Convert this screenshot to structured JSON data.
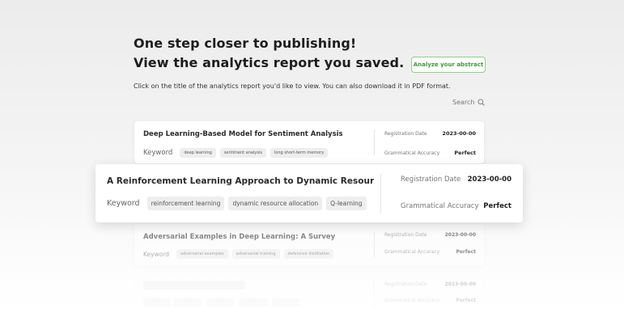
{
  "heading": {
    "line1": "One step closer to publishing!",
    "line2": "View the analytics report you saved."
  },
  "analyze_button": "Analyze your abstract",
  "instruction": "Click on the title of the analytics report you'd like to view. You can also download it in PDF format.",
  "search_label": "Search",
  "labels": {
    "keyword": "Keyword",
    "registration_date": "Registration Date",
    "grammatical_accuracy": "Grammatical Accuracy"
  },
  "reports": [
    {
      "title": "Deep Learning-Based Model for Sentiment Analysis",
      "keywords": [
        "deep learning",
        "sentiment analysis",
        "long short-term memory"
      ],
      "date": "2023-00-00",
      "accuracy": "Perfect"
    },
    {
      "title": "A Reinforcement Learning Approach to Dynamic Resource ...",
      "keywords": [
        "reinforcement learning",
        "dynamic resource allocation",
        "Q-learning"
      ],
      "date": "2023-00-00",
      "accuracy": "Perfect"
    },
    {
      "title": "Adversarial Examples in Deep Learning: A Survey",
      "keywords": [
        "adversarial examples",
        "adversarial training",
        "defensive distillation"
      ],
      "date": "2023-00-00",
      "accuracy": "Perfect"
    },
    {
      "title": "",
      "keywords": [],
      "date": "2023-00-00",
      "accuracy": "Perfect"
    }
  ],
  "colors": {
    "accent_green": "#3f9a39",
    "accent_border": "#8fcf85"
  },
  "icons": {
    "search": "magnifier"
  }
}
